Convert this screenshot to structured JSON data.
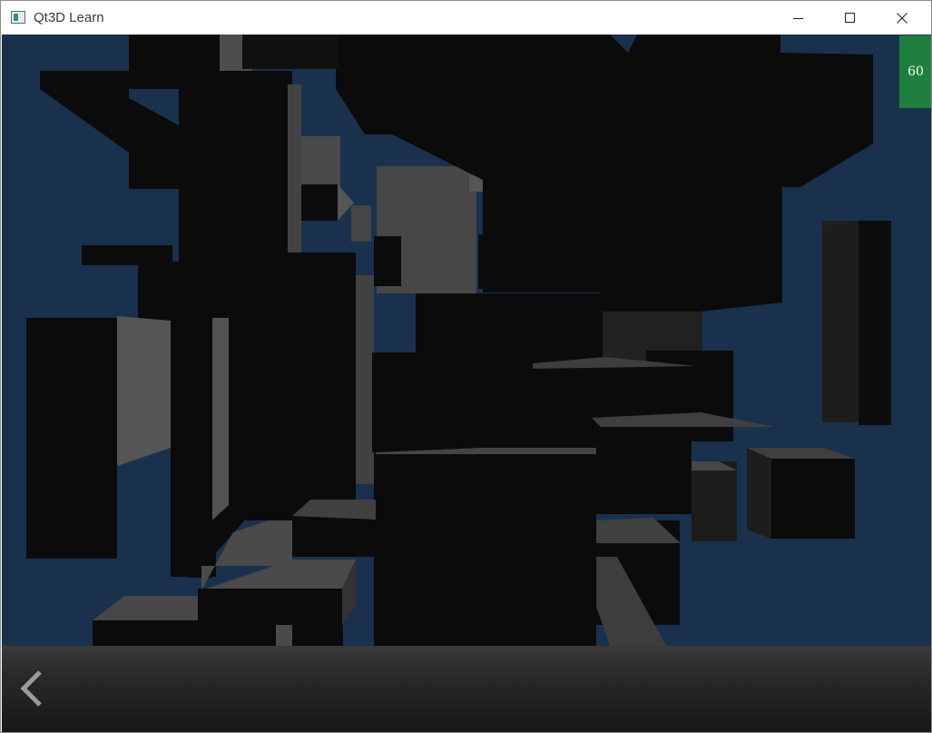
{
  "window": {
    "title": "Qt3D Learn",
    "controls": [
      "minimize-icon",
      "maximize-icon",
      "close-icon"
    ]
  },
  "scene": {
    "background_color": "#19314c",
    "shade_dark": "#0b0b0b",
    "shade_mid": "#3d3d3d",
    "shade_light": "#555555"
  },
  "fps_counter": {
    "value": "60",
    "color": "#1f7f3e"
  },
  "bottom_bar": {
    "back_icon": "chevron-left-icon"
  }
}
